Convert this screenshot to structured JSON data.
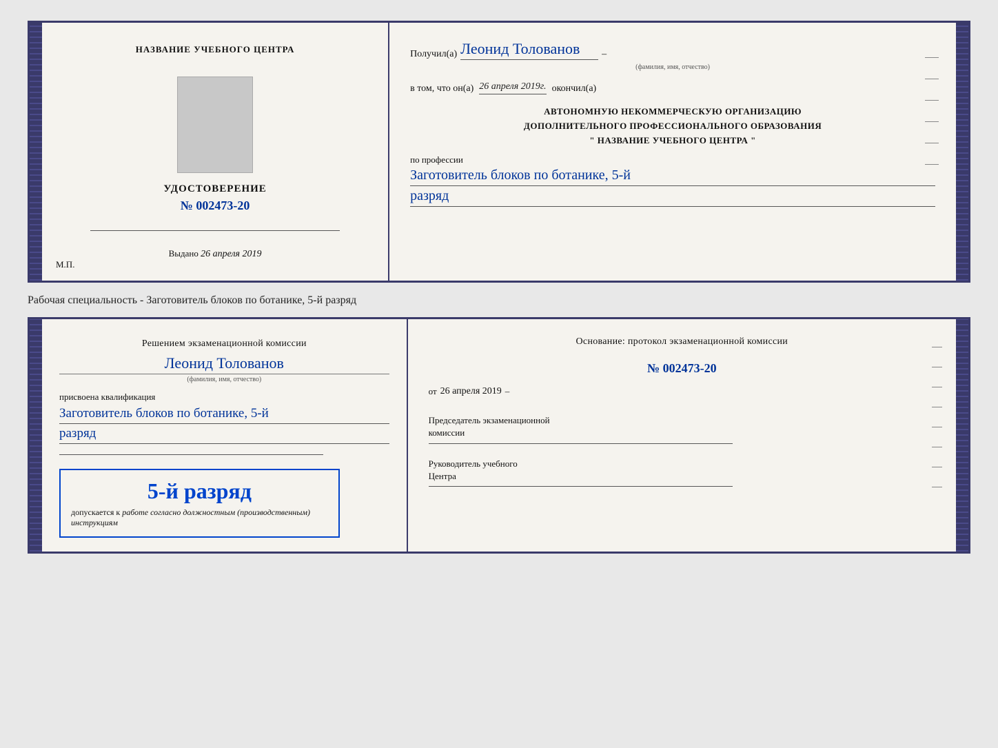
{
  "top_cert": {
    "left": {
      "center_title": "НАЗВАНИЕ УЧЕБНОГО ЦЕНТРА",
      "udostoverenie_label": "УДОСТОВЕРЕНИЕ",
      "number": "№ 002473-20",
      "vydano_label": "Выдано",
      "vydano_date": "26 апреля 2019",
      "mp_label": "М.П."
    },
    "right": {
      "poluchil_prefix": "Получил(а)",
      "name": "Леонид Толованов",
      "name_sub": "(фамилия, имя, отчество)",
      "vtom_prefix": "в том, что он(а)",
      "vtom_date": "26 апреля 2019г.",
      "okoncil": "окончил(а)",
      "avtonomnuyu_line1": "АВТОНОМНУЮ НЕКОММЕРЧЕСКУЮ ОРГАНИЗАЦИЮ",
      "avtonomnuyu_line2": "ДОПОЛНИТЕЛЬНОГО ПРОФЕССИОНАЛЬНОГО ОБРАЗОВАНИЯ",
      "avtonomnuyu_line3": "\"   НАЗВАНИЕ УЧЕБНОГО ЦЕНТРА   \"",
      "po_professii": "по профессии",
      "professiya": "Заготовитель блоков по ботанике, 5-й",
      "razryad": "разряд"
    }
  },
  "specialty_text": "Рабочая специальность - Заготовитель блоков по ботанике, 5-й разряд",
  "bottom_cert": {
    "left": {
      "resheniem_text": "Решением экзаменационной комиссии",
      "name": "Леонид Толованов",
      "fio_sub": "(фамилия, имя, отчество)",
      "prisvoena": "присвоена квалификация",
      "professiya": "Заготовитель блоков по ботанике, 5-й",
      "razryad": "разряд",
      "rank_display": "5-й разряд",
      "dopuskaetsya_prefix": "допускается к",
      "dopuskaetsya_italic": "работе согласно должностным (производственным) инструкциям"
    },
    "right": {
      "osnovanie": "Основание: протокол экзаменационной комиссии",
      "protocol_number": "№  002473-20",
      "ot_prefix": "от",
      "ot_date": "26 апреля 2019",
      "predsedatel_line1": "Председатель экзаменационной",
      "predsedatel_line2": "комиссии",
      "rukovoditel_line1": "Руководитель учебного",
      "rukovoditel_line2": "Центра"
    }
  }
}
